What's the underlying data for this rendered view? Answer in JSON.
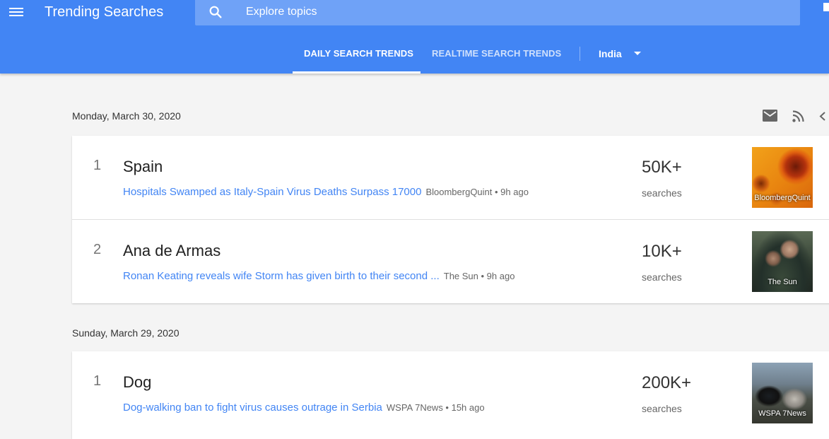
{
  "header": {
    "title": "Trending Searches",
    "search_placeholder": "Explore topics",
    "tabs": [
      {
        "label": "DAILY SEARCH TRENDS",
        "active": true
      },
      {
        "label": "REALTIME SEARCH TRENDS",
        "active": false
      }
    ],
    "country": "India",
    "accent_color": "#4285f4"
  },
  "days": [
    {
      "date": "Monday, March 30, 2020",
      "items": [
        {
          "rank": "1",
          "term": "Spain",
          "article": "Hospitals Swamped as Italy-Spain Virus Deaths Surpass 17000",
          "meta": "BloombergQuint • 9h ago",
          "volume": "50K+",
          "volume_label": "searches",
          "thumb_source": "BloombergQuint"
        },
        {
          "rank": "2",
          "term": "Ana de Armas",
          "article": "Ronan Keating reveals wife Storm has given birth to their second ...",
          "meta": "The Sun • 9h ago",
          "volume": "10K+",
          "volume_label": "searches",
          "thumb_source": "The Sun"
        }
      ]
    },
    {
      "date": "Sunday, March 29, 2020",
      "items": [
        {
          "rank": "1",
          "term": "Dog",
          "article": "Dog-walking ban to fight virus causes outrage in Serbia",
          "meta": "WSPA 7News • 15h ago",
          "volume": "200K+",
          "volume_label": "searches",
          "thumb_source": "WSPA 7News"
        }
      ]
    }
  ],
  "icons": [
    "menu-icon",
    "search-icon",
    "email-icon",
    "rss-icon",
    "share-icon",
    "dropdown-arrow-icon"
  ]
}
